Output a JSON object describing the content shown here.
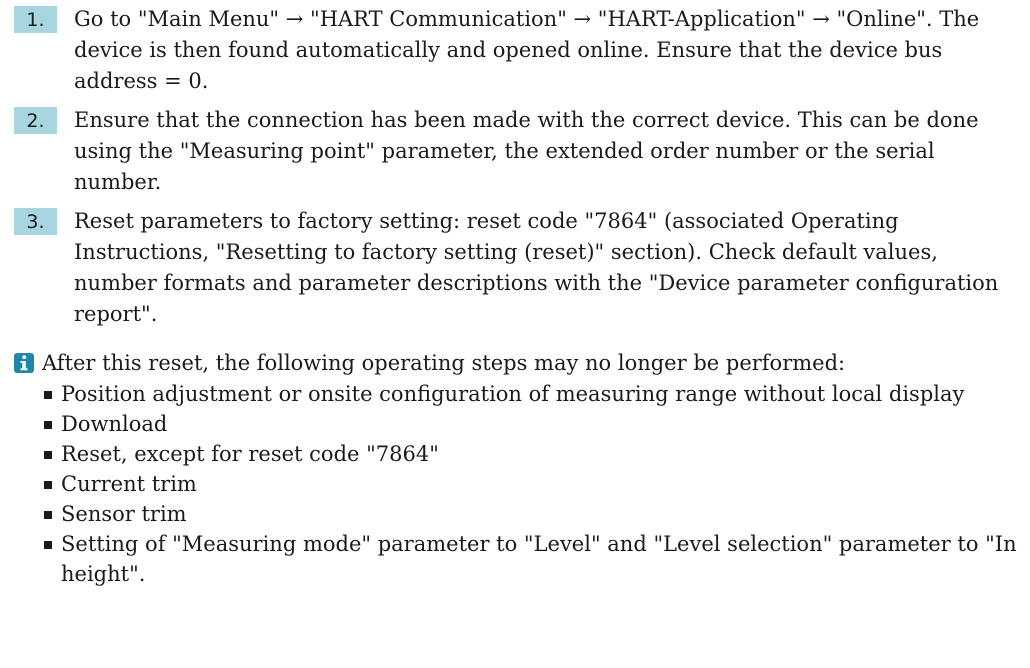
{
  "steps": [
    {
      "number": "1.",
      "text": "Go to \"Main Menu\" → \"HART Communication\" → \"HART-Application\" → \"Online\". The device is then found automatically and opened online. Ensure that the device bus address = 0."
    },
    {
      "number": "2.",
      "text": "Ensure that the connection has been made with the correct device. This can be done using the \"Measuring point\" parameter, the extended order number or the serial number."
    },
    {
      "number": "3.",
      "text": "Reset parameters to factory setting: reset code \"7864\" (associated Operating Instructions, \"Resetting to factory setting (reset)\" section). Check default values, number formats and parameter descriptions with the \"Device parameter configuration report\"."
    }
  ],
  "note": {
    "icon": "info-icon",
    "icon_color": "#1e87aa",
    "intro": "After this reset, the following operating steps may no longer be performed:",
    "items": [
      "Position adjustment or onsite configuration of measuring range without local display",
      "Download",
      "Reset, except for reset code \"7864\"",
      "Current trim",
      "Sensor trim",
      "Setting of \"Measuring mode\" parameter to \"Level\" and \"Level selection\" parameter to \"In height\"."
    ]
  }
}
